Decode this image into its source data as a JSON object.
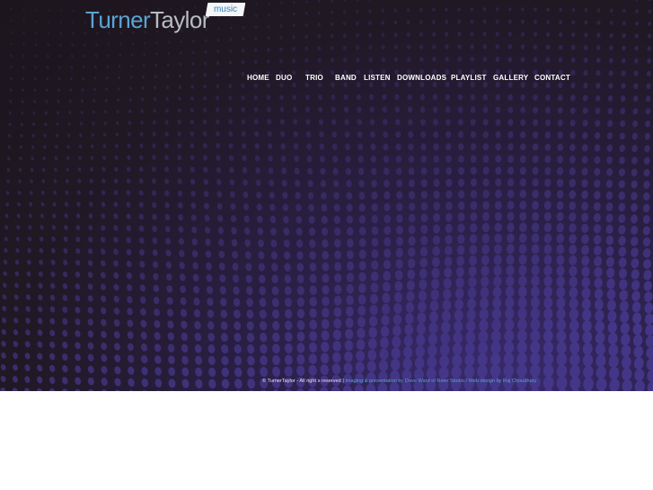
{
  "logo": {
    "turner": "Turner",
    "taylor": "Taylor",
    "badge": "music"
  },
  "nav": {
    "items": [
      {
        "label": "HOME"
      },
      {
        "label": "DUO"
      },
      {
        "label": "TRIO"
      },
      {
        "label": "BAND"
      },
      {
        "label": "LISTEN"
      },
      {
        "label": "DOWNLOADS"
      },
      {
        "label": "PLAYLIST"
      },
      {
        "label": "GALLERY"
      },
      {
        "label": "CONTACT"
      }
    ]
  },
  "footer": {
    "copyright": "© TurnerTaylor - All right s reserved",
    "separator": "|",
    "imaging_credit": "Imaging & presentation by Dave Ward of River Studio",
    "separator2": "/",
    "design_credit": "Web design by Raj Choudhury"
  },
  "colors": {
    "brand_blue": "#5aa3d4",
    "background_dark": "#201823",
    "accent_purple": "#3a2a6e"
  }
}
